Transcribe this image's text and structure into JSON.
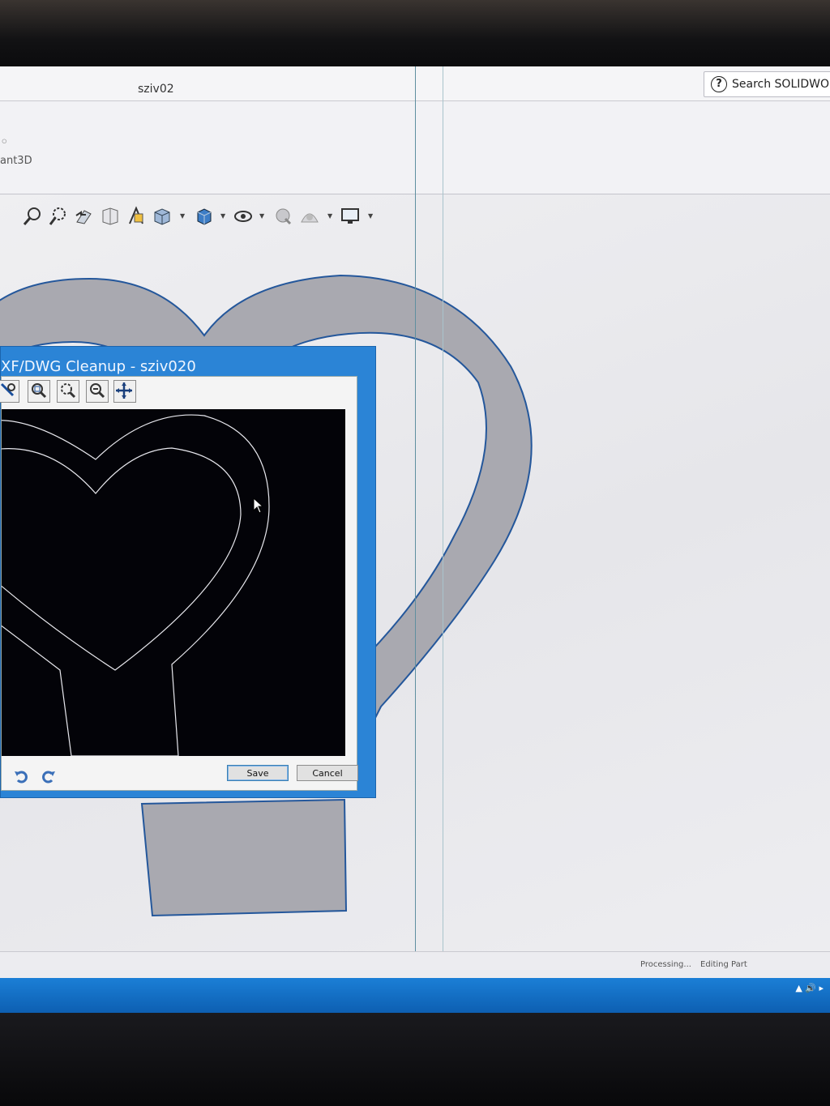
{
  "window": {
    "document_title": "sziv02",
    "search_placeholder": "Search SOLIDWORKS"
  },
  "ribbon": {
    "partial_command_label": "ant3D"
  },
  "heads_up_toolbar": {
    "icons": [
      "zoom-to-fit-icon",
      "zoom-to-area-icon",
      "previous-view-icon",
      "section-view-icon",
      "dynamic-annotation-icon",
      "view-orientation-icon",
      "display-style-icon",
      "hide-show-items-icon",
      "edit-appearance-icon",
      "apply-scene-icon",
      "view-settings-icon"
    ]
  },
  "dialog": {
    "title": "XF/DWG Cleanup - sziv020",
    "toolbar_icons": [
      "select-icon",
      "zoom-to-fit-icon",
      "zoom-to-area-icon",
      "zoom-in-out-icon",
      "pan-icon"
    ],
    "save_label": "Save",
    "cancel_label": "Cancel"
  },
  "status_bar": {
    "processing": "Processing...",
    "mode": "Editing Part"
  },
  "colors": {
    "taskbar": "#0d6fc6",
    "dialog_frame": "#2b84d6",
    "preview_background": "#030308",
    "part_fill": "#a9a9b0"
  }
}
